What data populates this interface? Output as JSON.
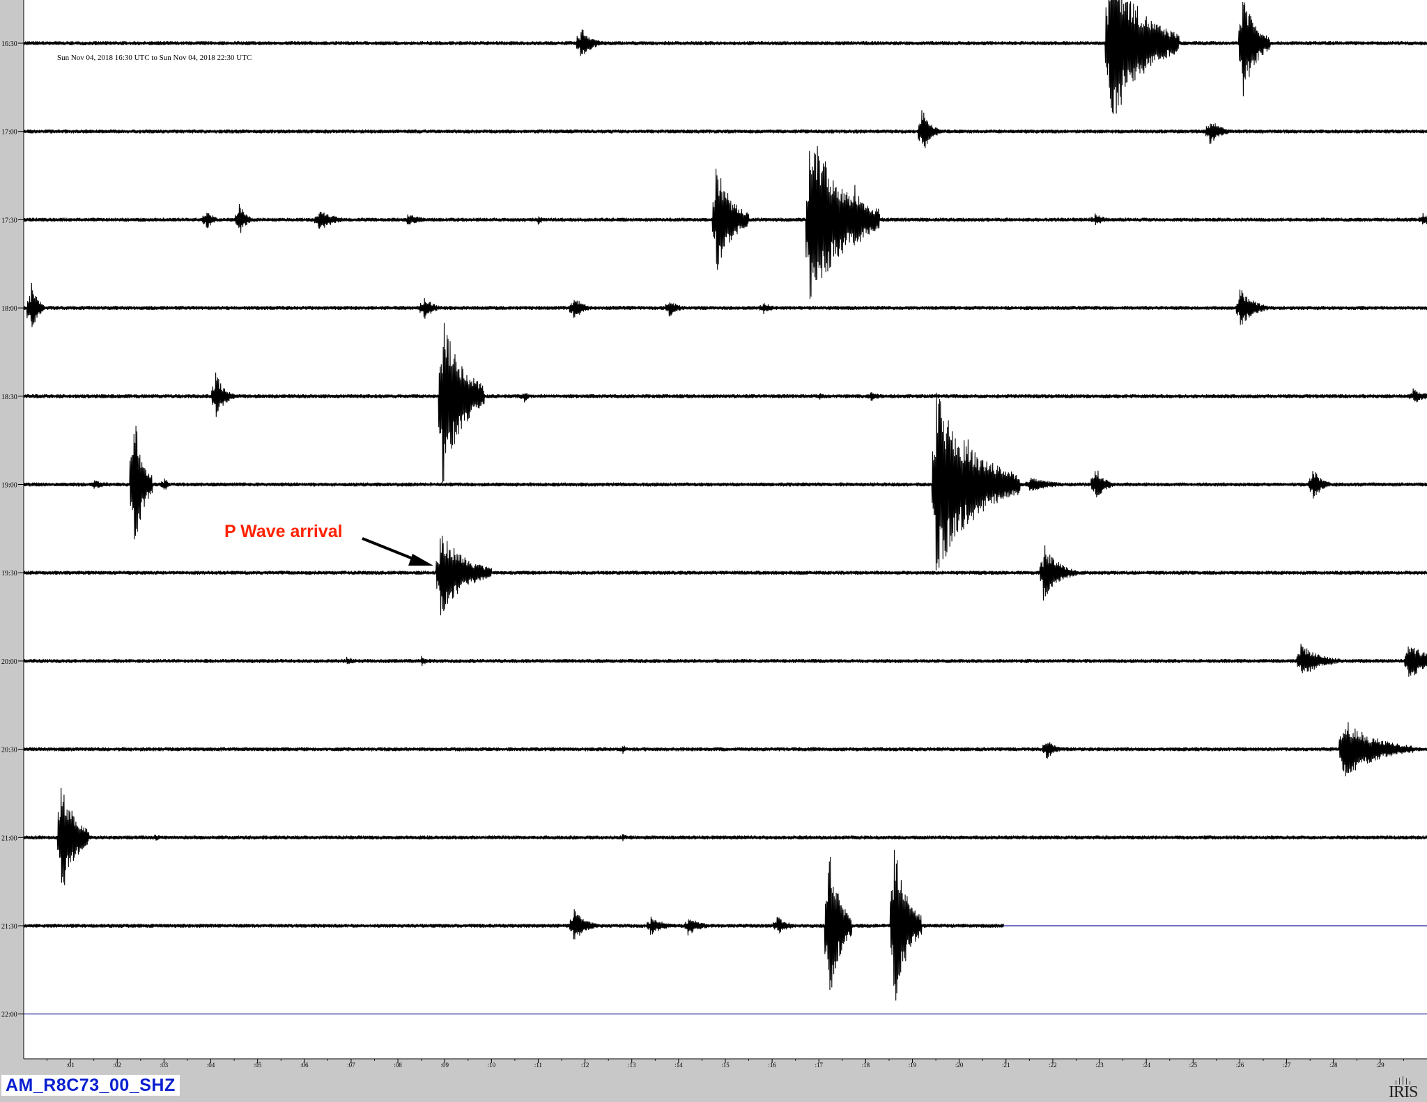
{
  "header": {
    "date_range": "Sun Nov 04, 2018 16:30 UTC to Sun Nov 04, 2018 22:30 UTC"
  },
  "footer": {
    "station": "AM_R8C73_00_SHZ",
    "logo": "IRIS"
  },
  "annotation": {
    "label": "P Wave arrival",
    "color": "#ff2200"
  },
  "colors": {
    "trace": "#000000",
    "flat_line": "#1a1aa0",
    "plot_bg": "#ffffff",
    "frame_bg": "#c8c8c8",
    "station_text": "#0a1fd0"
  },
  "chart_data": {
    "type": "line",
    "title": "Sun Nov 04, 2018 16:30 UTC to Sun Nov 04, 2018 22:30 UTC",
    "xlabel": "",
    "ylabel": "",
    "x_unit": "minutes",
    "xlim": [
      0,
      30
    ],
    "x_ticks": [
      ":01",
      ":02",
      ":03",
      ":04",
      ":05",
      ":06",
      ":07",
      ":08",
      ":09",
      ":10",
      ":11",
      ":12",
      ":13",
      ":14",
      ":15",
      ":16",
      ":17",
      ":18",
      ":19",
      ":20",
      ":21",
      ":22",
      ":23",
      ":24",
      ":25",
      ":26",
      ":27",
      ":28",
      ":29"
    ],
    "row_labels": [
      "16:30",
      "17:00",
      "17:30",
      "18:00",
      "18:30",
      "19:00",
      "19:30",
      "20:00",
      "20:30",
      "21:00",
      "21:30",
      "22:00"
    ],
    "grid": false,
    "rows": [
      {
        "label": "16:30",
        "events": [
          {
            "t": 11.9,
            "amp": 0.18,
            "dur": 0.5
          },
          {
            "t": 23.2,
            "amp": 0.9,
            "dur": 1.5
          },
          {
            "t": 26.05,
            "amp": 0.6,
            "dur": 0.6
          }
        ]
      },
      {
        "label": "17:00",
        "events": [
          {
            "t": 19.2,
            "amp": 0.25,
            "dur": 0.4
          },
          {
            "t": 25.35,
            "amp": 0.14,
            "dur": 0.5
          }
        ]
      },
      {
        "label": "17:30",
        "events": [
          {
            "t": 3.9,
            "amp": 0.12,
            "dur": 0.3
          },
          {
            "t": 4.6,
            "amp": 0.18,
            "dur": 0.3
          },
          {
            "t": 6.3,
            "amp": 0.12,
            "dur": 0.7
          },
          {
            "t": 8.2,
            "amp": 0.06,
            "dur": 0.8
          },
          {
            "t": 11.0,
            "amp": 0.06,
            "dur": 0.2
          },
          {
            "t": 14.8,
            "amp": 0.6,
            "dur": 0.7
          },
          {
            "t": 16.8,
            "amp": 0.95,
            "dur": 1.5
          },
          {
            "t": 17.75,
            "amp": 0.4,
            "dur": 0.5
          },
          {
            "t": 22.9,
            "amp": 0.07,
            "dur": 0.5
          },
          {
            "t": 29.9,
            "amp": 0.07,
            "dur": 0.5
          }
        ]
      },
      {
        "label": "18:00",
        "events": [
          {
            "t": 0.15,
            "amp": 0.3,
            "dur": 0.3
          },
          {
            "t": 8.55,
            "amp": 0.14,
            "dur": 0.4
          },
          {
            "t": 11.75,
            "amp": 0.14,
            "dur": 0.4
          },
          {
            "t": 13.8,
            "amp": 0.1,
            "dur": 0.4
          },
          {
            "t": 15.8,
            "amp": 0.07,
            "dur": 0.4
          },
          {
            "t": 26.0,
            "amp": 0.22,
            "dur": 0.6
          }
        ]
      },
      {
        "label": "18:30",
        "events": [
          {
            "t": 4.1,
            "amp": 0.25,
            "dur": 0.4
          },
          {
            "t": 8.95,
            "amp": 0.95,
            "dur": 0.9
          },
          {
            "t": 10.7,
            "amp": 0.07,
            "dur": 0.2
          },
          {
            "t": 17.0,
            "amp": 0.04,
            "dur": 0.3
          },
          {
            "t": 18.1,
            "amp": 0.06,
            "dur": 0.4
          },
          {
            "t": 29.7,
            "amp": 0.08,
            "dur": 0.6
          }
        ]
      },
      {
        "label": "19:00",
        "events": [
          {
            "t": 1.5,
            "amp": 0.06,
            "dur": 0.5
          },
          {
            "t": 2.35,
            "amp": 0.8,
            "dur": 0.4
          },
          {
            "t": 3.0,
            "amp": 0.08,
            "dur": 0.2
          },
          {
            "t": 19.5,
            "amp": 0.95,
            "dur": 1.8
          },
          {
            "t": 20.15,
            "amp": 0.6,
            "dur": 0.4
          },
          {
            "t": 21.5,
            "amp": 0.08,
            "dur": 1.0
          },
          {
            "t": 22.9,
            "amp": 0.2,
            "dur": 0.4
          },
          {
            "t": 27.55,
            "amp": 0.18,
            "dur": 0.4
          }
        ]
      },
      {
        "label": "19:30",
        "events": [
          {
            "t": 8.9,
            "amp": 0.45,
            "dur": 1.1
          },
          {
            "t": 21.8,
            "amp": 0.3,
            "dur": 0.7
          }
        ]
      },
      {
        "label": "20:00",
        "events": [
          {
            "t": 6.9,
            "amp": 0.06,
            "dur": 0.3
          },
          {
            "t": 8.5,
            "amp": 0.06,
            "dur": 0.3
          },
          {
            "t": 27.3,
            "amp": 0.18,
            "dur": 0.9
          },
          {
            "t": 29.6,
            "amp": 0.22,
            "dur": 0.8
          }
        ]
      },
      {
        "label": "20:30",
        "events": [
          {
            "t": 12.8,
            "amp": 0.06,
            "dur": 0.2
          },
          {
            "t": 21.85,
            "amp": 0.12,
            "dur": 0.4
          },
          {
            "t": 28.2,
            "amp": 0.32,
            "dur": 1.5
          }
        ]
      },
      {
        "label": "21:00",
        "events": [
          {
            "t": 0.8,
            "amp": 0.65,
            "dur": 0.6
          },
          {
            "t": 2.8,
            "amp": 0.04,
            "dur": 0.4
          },
          {
            "t": 12.8,
            "amp": 0.04,
            "dur": 0.3
          }
        ]
      },
      {
        "label": "21:30",
        "events": [
          {
            "t": 11.75,
            "amp": 0.2,
            "dur": 0.5
          },
          {
            "t": 13.4,
            "amp": 0.1,
            "dur": 0.6
          },
          {
            "t": 14.2,
            "amp": 0.1,
            "dur": 0.6
          },
          {
            "t": 16.1,
            "amp": 0.1,
            "dur": 0.5
          },
          {
            "t": 17.2,
            "amp": 0.9,
            "dur": 0.5
          },
          {
            "t": 18.6,
            "amp": 0.9,
            "dur": 0.6
          }
        ],
        "data_end": 20.95
      },
      {
        "label": "22:00",
        "events": [],
        "data_end": 0
      }
    ]
  }
}
